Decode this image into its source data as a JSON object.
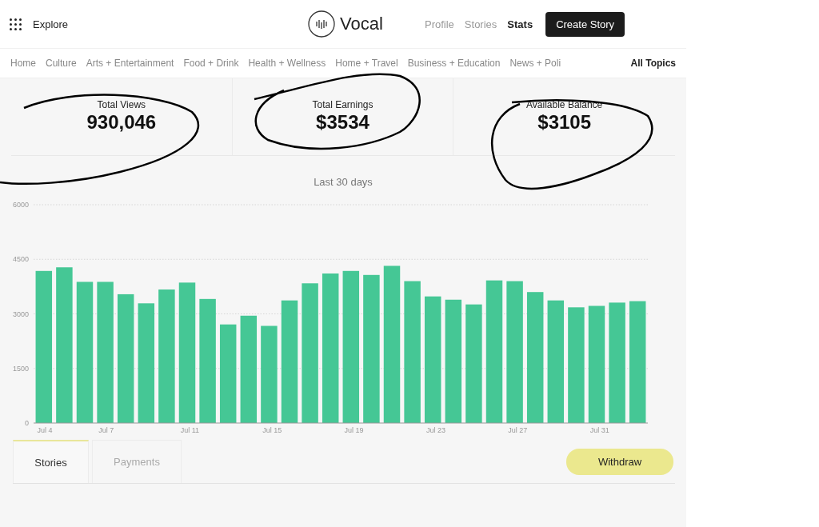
{
  "header": {
    "explore": "Explore",
    "logo": "Vocal",
    "links": [
      {
        "label": "Profile",
        "selected": false
      },
      {
        "label": "Stories",
        "selected": false
      },
      {
        "label": "Stats",
        "selected": true
      }
    ],
    "create_button": "Create Story"
  },
  "topics": {
    "items": [
      "Home",
      "Culture",
      "Arts + Entertainment",
      "Food + Drink",
      "Health + Wellness",
      "Home + Travel",
      "Business + Education",
      "News + Poli"
    ],
    "all": "All Topics"
  },
  "stats": [
    {
      "label": "Total Views",
      "value": "930,046"
    },
    {
      "label": "Total Earnings",
      "value": "$3534"
    },
    {
      "label": "Available Balance",
      "value": "$3105"
    }
  ],
  "period": "Last 30 days",
  "chart_data": {
    "type": "bar",
    "categories": [
      "Jul 4",
      null,
      null,
      "Jul 7",
      null,
      null,
      null,
      "Jul 11",
      null,
      null,
      null,
      "Jul 15",
      null,
      null,
      null,
      "Jul 19",
      null,
      null,
      null,
      "Jul 23",
      null,
      null,
      null,
      "Jul 27",
      null,
      null,
      null,
      "Jul 31",
      null,
      null
    ],
    "series": [
      {
        "color": "#45c795",
        "values": [
          4180,
          4280,
          3880,
          3880,
          3540,
          3290,
          3670,
          3860,
          3410,
          2710,
          2950,
          2670,
          3370,
          3840,
          4110,
          4180,
          4070,
          4320,
          3900,
          3480,
          3390,
          3260,
          3920,
          3900,
          3600,
          3370,
          3180,
          3220,
          3310,
          3350
        ]
      }
    ],
    "ylim": [
      0,
      6000
    ],
    "yticks": [
      0,
      1500,
      3000,
      4500,
      6000
    ],
    "grid": true
  },
  "tabs": [
    {
      "label": "Stories",
      "selected": true
    },
    {
      "label": "Payments",
      "selected": false
    }
  ],
  "withdraw_button": "Withdraw"
}
